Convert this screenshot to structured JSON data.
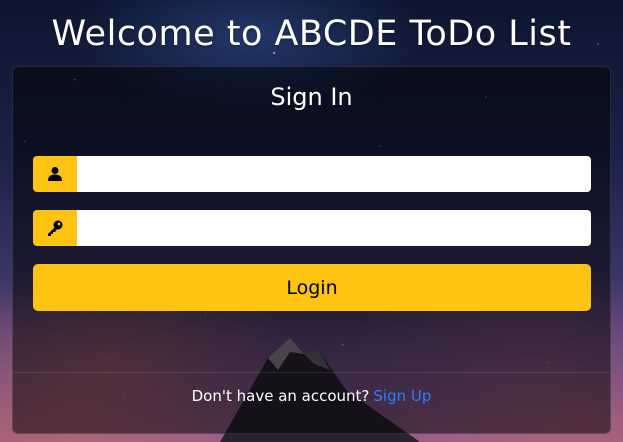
{
  "page": {
    "title": "Welcome to ABCDE ToDo List"
  },
  "signin": {
    "heading": "Sign In",
    "username": {
      "icon": "user-icon",
      "value": "",
      "placeholder": ""
    },
    "password": {
      "icon": "key-icon",
      "value": "",
      "placeholder": ""
    },
    "login_label": "Login",
    "footer_text": "Don't have an account?",
    "signup_link": "Sign Up"
  },
  "colors": {
    "accent": "#ffc312",
    "link": "#2e7dff",
    "card_bg": "rgba(0,0,0,0.5)"
  }
}
